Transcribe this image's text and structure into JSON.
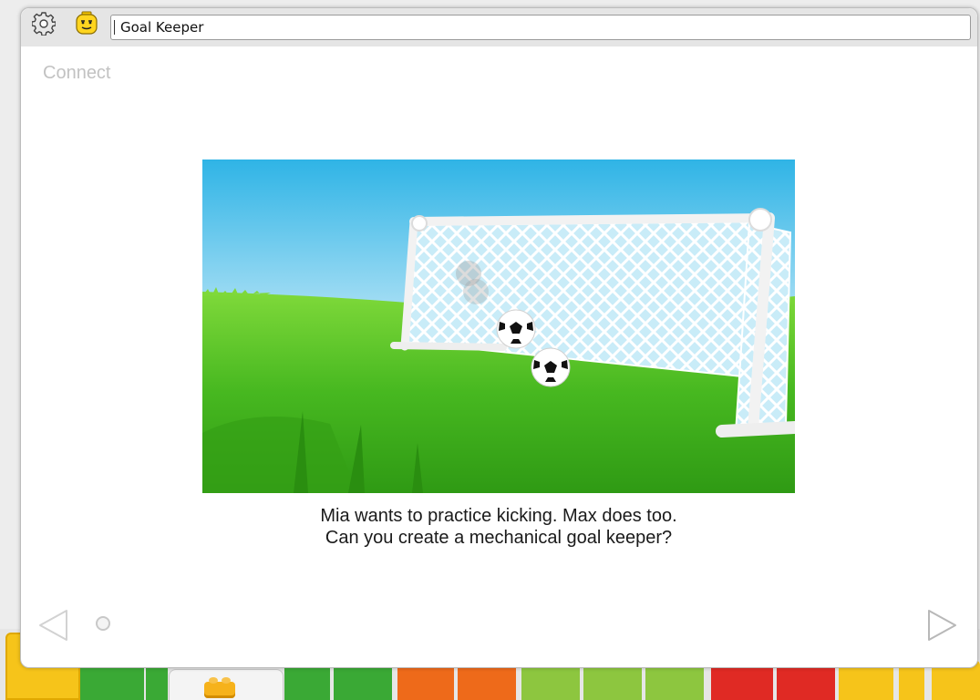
{
  "window": {
    "title": "Goal Keeper",
    "section": "Connect"
  },
  "caption": {
    "line1": "Mia wants to practice kicking. Max does too.",
    "line2": "Can you create a mechanical goal keeper?"
  },
  "icons": {
    "settings": "gear-icon",
    "author": "minifig-face-icon",
    "previous": "left-triangle-icon",
    "next": "right-triangle-icon",
    "page": "page-dot-icon",
    "palette_tab": "lego-brick-icon"
  },
  "pagination": {
    "current": 1,
    "total": 1
  },
  "colors": {
    "sky_top": "#2fb4e6",
    "grass": "#3cb01c",
    "palette_yellow": "#f6c41a",
    "palette_green": "#3aa935",
    "palette_orange": "#ee6a1a",
    "palette_red": "#e02a24"
  }
}
